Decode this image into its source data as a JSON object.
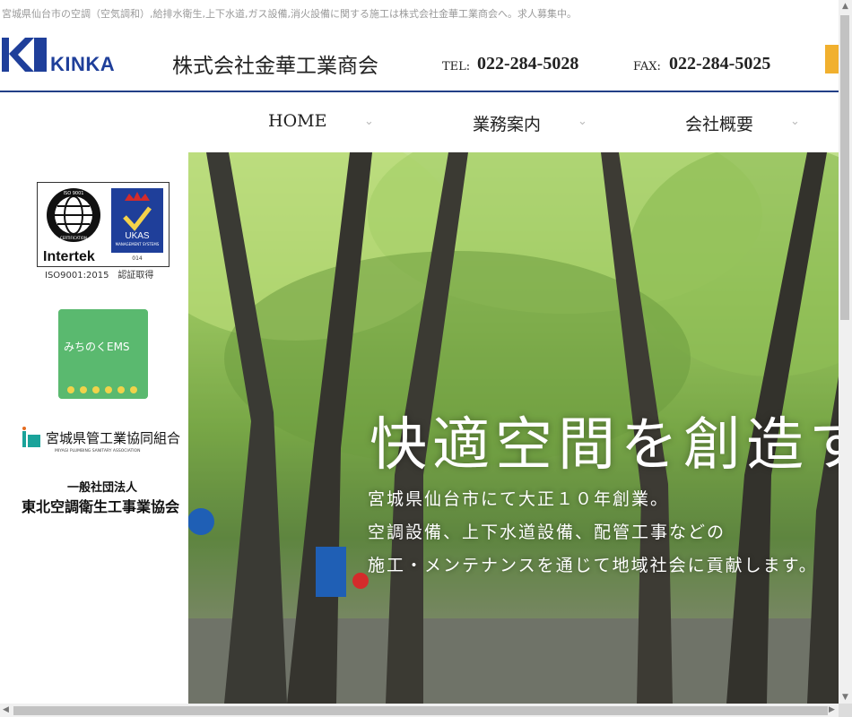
{
  "header": {
    "tagline": "宮城県仙台市の空調（空気調和）,給排水衛生,上下水道,ガス設備,消火設備に関する施工は株式会社金華工業商会へ。求人募集中。",
    "logo_text": "KINKA",
    "company_name": "株式会社金華工業商会",
    "tel_label": "TEL:",
    "tel_number": "022-284-5028",
    "fax_label": "FAX:",
    "fax_number": "022-284-5025",
    "accent_color": "#f1b02e",
    "line_color": "#223f86"
  },
  "nav": {
    "items": [
      {
        "label": "HOME"
      },
      {
        "label": "業務案内"
      },
      {
        "label": "会社概要"
      }
    ]
  },
  "sidebar": {
    "iso_brand": "Intertek",
    "iso_ring_top": "ISO 9001",
    "iso_ring_bottom": "CERTIFICATION",
    "ukas": "UKAS",
    "ukas_sub": "MANAGEMENT SYSTEMS",
    "ukas_num": "014",
    "iso_caption": "ISO9001:2015　認証取得",
    "miraku_text": "みちのくEMS",
    "kyokai1_name": "宮城県管工業協同組合",
    "kyokai1_sub": "MIYAGI PLUMBING SANITARY ASSOCIATION",
    "kyokai2_line1": "一般社団法人",
    "kyokai2_line2": "東北空調衛生工事業協会"
  },
  "hero": {
    "title": "快適空間を創造す",
    "lines": [
      "宮城県仙台市にて大正１０年創業。",
      "空調設備、上下水道設備、配管工事などの",
      "施工・メンテナンスを通じて地域社会に貢献します。"
    ]
  }
}
